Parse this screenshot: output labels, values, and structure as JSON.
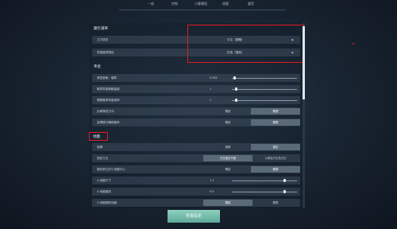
{
  "nav": {
    "tabs": [
      "一般",
      "控制",
      "小算畫面",
      "遊戲",
      "聲音"
    ]
  },
  "sections": {
    "display_title": "顯示選單",
    "aim_title": "準星",
    "map_title": "地圖"
  },
  "display": {
    "language": {
      "label": "文字語言",
      "value": "中文（繁體）",
      "arrow": "▶"
    },
    "reticle_color": {
      "label": "準星瞄準顏色",
      "value": "紅色（預設）",
      "arrow": "▶"
    }
  },
  "aim": {
    "sliders": [
      {
        "label": "滑鼠靈敏：瞄準",
        "value": "0.562",
        "level": 0.03
      },
      {
        "label": "瞄準準星聯動幅度",
        "value": "1",
        "level": 0.05
      },
      {
        "label": "開鏡瞄準準星速率",
        "value": "1",
        "level": 0.05
      }
    ],
    "toggles": [
      {
        "label": "反轉滑鼠方向",
        "options": [
          "開啟",
          "關閉"
        ],
        "selected": 1
      },
      {
        "label": "游標模式輔助瞄準",
        "options": [
          "開啟",
          "關閉"
        ],
        "selected": 1
      }
    ]
  },
  "map": {
    "toggle_rows": [
      {
        "label": "旋轉",
        "options": [
          "旋轉",
          "固定"
        ],
        "selected": 1
      },
      {
        "label": "固定方位",
        "options": [
          "方位固定不變",
          "以角色方位為方位"
        ],
        "selected": 0
      },
      {
        "label": "讓玩家位於小地圖中心",
        "options": [
          "開啟",
          "關閉"
        ],
        "selected": 1
      }
    ],
    "sliders": [
      {
        "label": "小地圖尺寸",
        "value": "1.1",
        "level": 0.8
      },
      {
        "label": "小地圖縮放",
        "value": "0.9",
        "level": 0.8
      }
    ],
    "last_toggle": {
      "label": "小地圖讀取地圖",
      "options": [
        "開啟",
        "關閉"
      ],
      "selected": 0
    }
  },
  "footer": {
    "reset_label": "恢復設定"
  },
  "colors": {
    "accent": "#e11b24",
    "button": "#6fb8a8",
    "selected": "#5a6a78"
  }
}
